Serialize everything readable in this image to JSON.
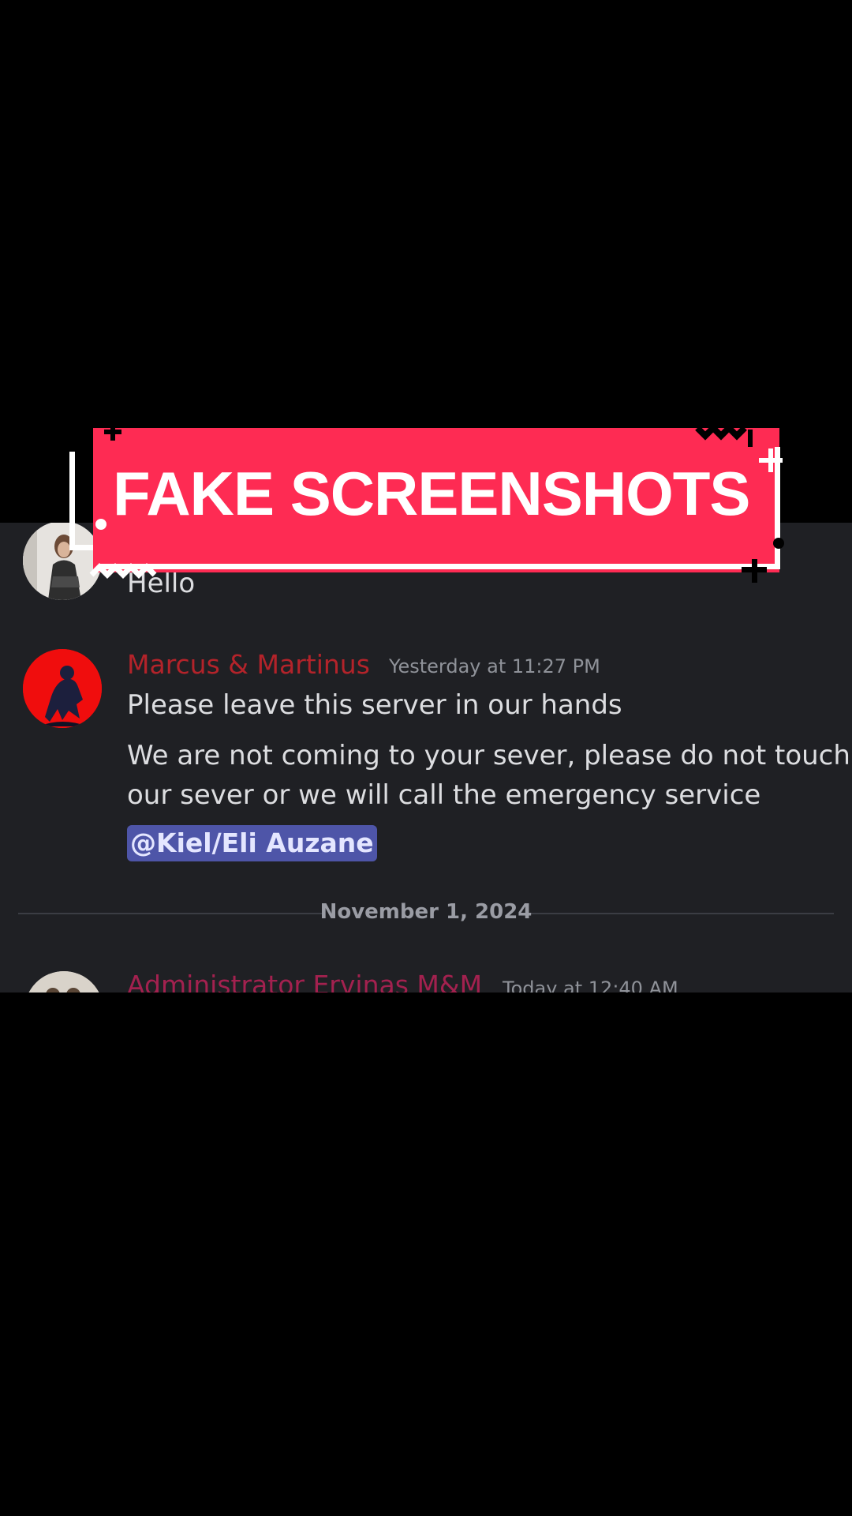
{
  "banner": {
    "title": "FAKE SCREENSHOTS"
  },
  "messages": [
    {
      "author": "",
      "timestamp": "",
      "lines": [
        "Hello"
      ]
    },
    {
      "author": "Marcus & Martinus",
      "author_color": "#b3232a",
      "timestamp": "Yesterday at 11:27 PM",
      "lines": [
        "Please leave this server in our hands",
        "We are not coming to your sever, please do not touch",
        "our sever or we will call the emergency service"
      ],
      "mention": "@Kiel/Eli Auzane"
    },
    {
      "author": "Administrator Ervinas M&M",
      "author_color": "#a3214f",
      "timestamp": "Today at 12:40 AM"
    }
  ],
  "date_divider": "November 1, 2024",
  "colors": {
    "banner": "#fe2b53",
    "chat_background": "#1f2024",
    "mention_background": "#4e55a8"
  }
}
